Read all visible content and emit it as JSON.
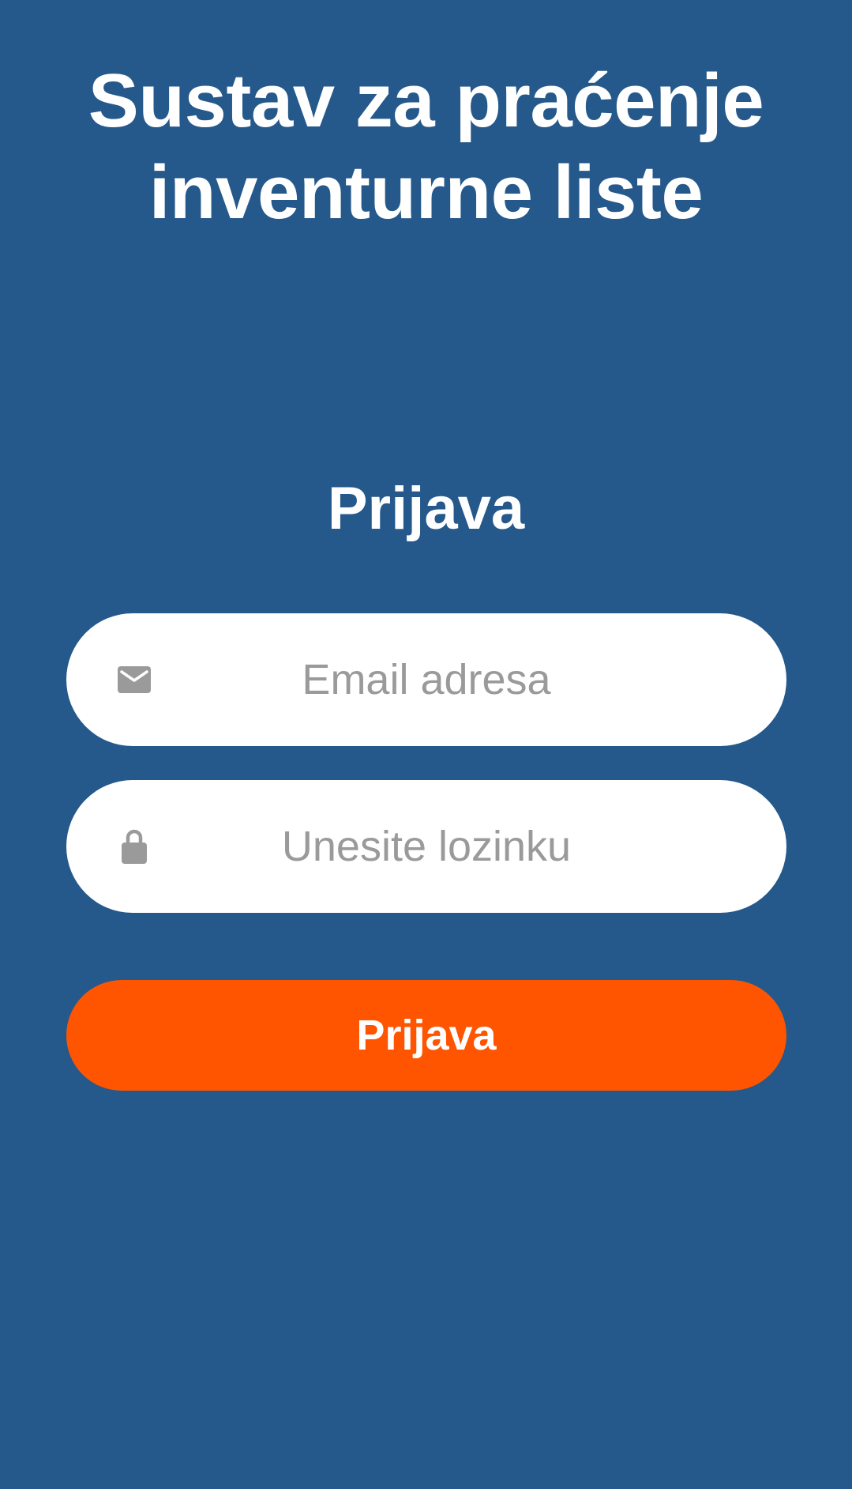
{
  "header": {
    "title_line1": "Sustav za praćenje",
    "title_line2": "inventurne liste"
  },
  "login": {
    "heading": "Prijava",
    "email": {
      "value": "",
      "placeholder": "Email adresa",
      "icon": "envelope-icon"
    },
    "password": {
      "value": "",
      "placeholder": "Unesite lozinku",
      "icon": "lock-icon"
    },
    "submit_label": "Prijava"
  },
  "colors": {
    "background": "#25588b",
    "accent": "#ff5500",
    "field_background": "#ffffff",
    "icon": "#9a9a9a",
    "placeholder": "#9a9a9a"
  }
}
